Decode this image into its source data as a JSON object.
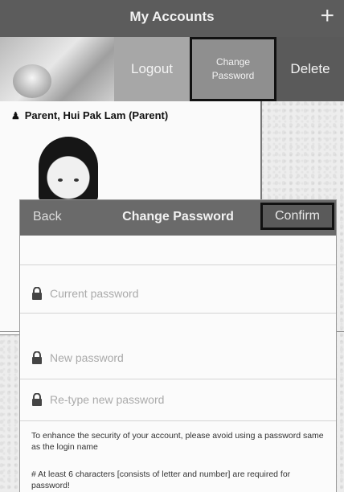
{
  "header": {
    "title": "My Accounts",
    "add_icon": "plus-icon"
  },
  "account_actions": {
    "logout": "Logout",
    "change_password_line1": "Change",
    "change_password_line2": "Password",
    "delete": "Delete"
  },
  "account": {
    "name": "Parent, Hui Pak Lam (Parent)",
    "user_icon": "user-icon"
  },
  "modal": {
    "back": "Back",
    "title": "Change Password",
    "confirm": "Confirm",
    "fields": [
      {
        "placeholder": "Current password",
        "value": ""
      },
      {
        "placeholder": "New password",
        "value": ""
      },
      {
        "placeholder": "Re-type new password",
        "value": ""
      }
    ],
    "note1": "To enhance the security of your account, please avoid using a password same as the login name",
    "note2": "# At least 6 characters [consists of letter and number] are required for password!"
  }
}
